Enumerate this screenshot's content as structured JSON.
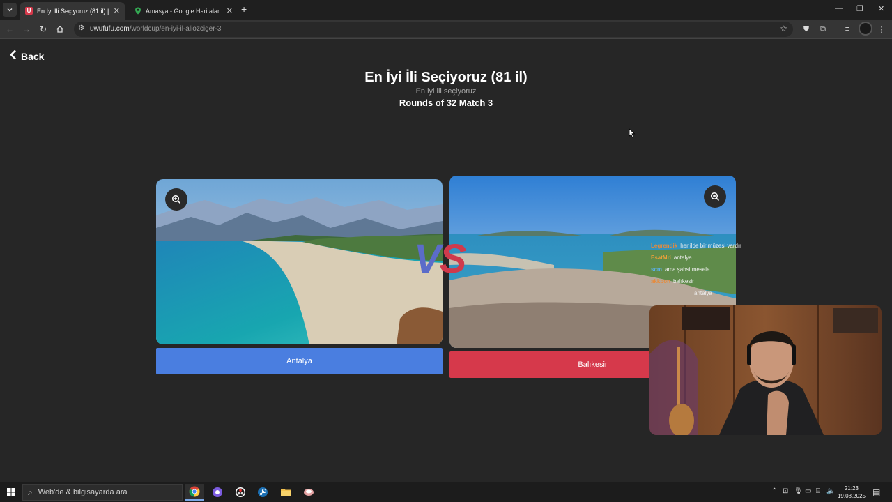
{
  "browser": {
    "tabs": [
      {
        "title": "En İyi İli Seçiyoruz (81 il) | UwUf",
        "favicon": "U",
        "active": true
      },
      {
        "title": "Amasya - Google Haritalar",
        "favicon": "map-pin",
        "active": false
      }
    ],
    "url_host": "uwufufu.com",
    "url_path": "/worldcup/en-iyi-il-aliozciger-3"
  },
  "page": {
    "back_label": "Back",
    "title": "En İyi İli Seçiyoruz (81 il)",
    "subtitle": "En iyi ili seçiyoruz",
    "round": "Rounds of 32 Match 3",
    "vs_v": "V",
    "vs_s": "S",
    "left_choice": {
      "label": "Antalya",
      "color": "#4a7ee0"
    },
    "right_choice": {
      "label": "Balıkesir",
      "color": "#d6394b"
    }
  },
  "chat": [
    {
      "user": "Legrendik",
      "msg": "her ilde bir müzesi vardır",
      "user_color": "#e88b3a"
    },
    {
      "user": "EsatMri",
      "msg": "antalya",
      "user_color": "#e8a03a"
    },
    {
      "user": "scm",
      "msg": "ama şahsi mesele",
      "user_color": "#5ab0e6"
    },
    {
      "user": "akkbon",
      "msg": "balıkesir",
      "user_color": "#e88b3a"
    },
    {
      "user": "",
      "msg": "antalya",
      "user_color": "#7ad07a"
    }
  ],
  "taskbar": {
    "search_placeholder": "Web'de & bilgisayarda ara",
    "time": "21:23",
    "date": "19.08.2025"
  }
}
